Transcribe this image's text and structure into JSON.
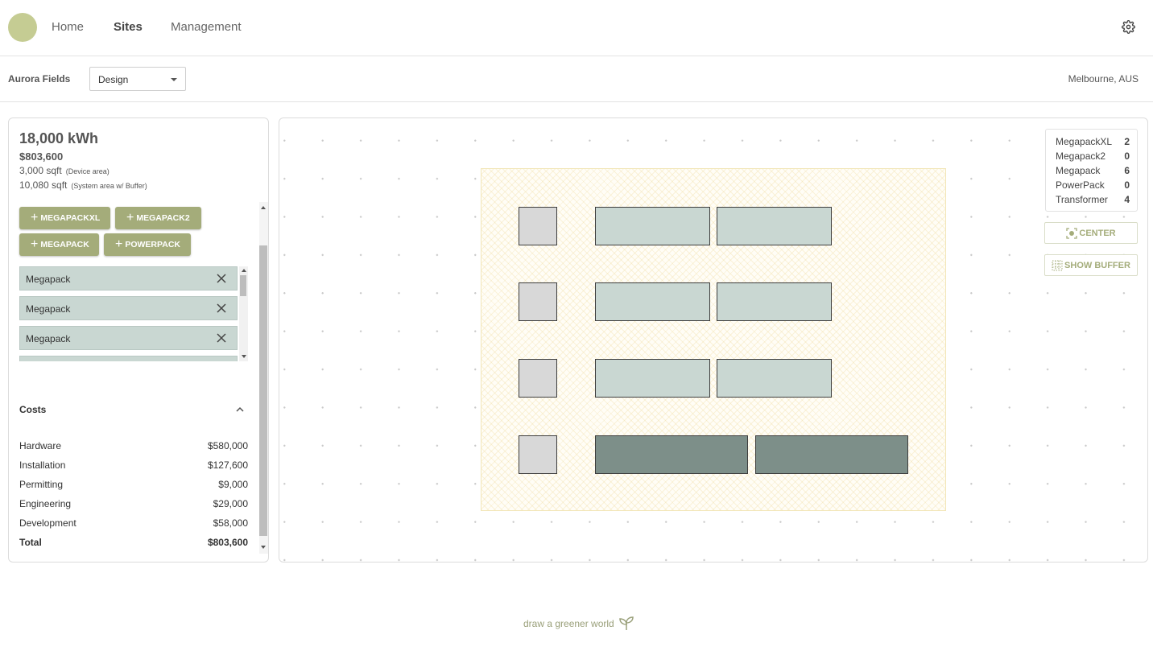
{
  "nav": {
    "links": [
      "Home",
      "Sites",
      "Management"
    ],
    "active": "Sites"
  },
  "site": {
    "name": "Aurora Fields",
    "mode": "Design",
    "location": "Melbourne, AUS"
  },
  "summary": {
    "energy": "18,000 kWh",
    "cost": "$803,600",
    "device_area": "3,000 sqft",
    "device_area_note": "(Device area)",
    "system_area": "10,080 sqft",
    "system_area_note": "(System area w/ Buffer)"
  },
  "add_buttons": [
    "MEGAPACKXL",
    "MEGAPACK2",
    "MEGAPACK",
    "POWERPACK"
  ],
  "devices": [
    "Megapack",
    "Megapack",
    "Megapack"
  ],
  "costs": {
    "title": "Costs",
    "rows": [
      {
        "name": "Hardware",
        "amount": "$580,000"
      },
      {
        "name": "Installation",
        "amount": "$127,600"
      },
      {
        "name": "Permitting",
        "amount": "$9,000"
      },
      {
        "name": "Engineering",
        "amount": "$29,000"
      },
      {
        "name": "Development",
        "amount": "$58,000"
      }
    ],
    "total_label": "Total",
    "total_amount": "$803,600"
  },
  "legend": [
    {
      "name": "MegapackXL",
      "count": "2"
    },
    {
      "name": "Megapack2",
      "count": "0"
    },
    {
      "name": "Megapack",
      "count": "6"
    },
    {
      "name": "PowerPack",
      "count": "0"
    },
    {
      "name": "Transformer",
      "count": "4"
    }
  ],
  "tools": {
    "center": "CENTER",
    "show_buffer": "SHOW BUFFER"
  },
  "footer": {
    "tagline": "draw a greener world"
  },
  "colors": {
    "accent": "#a4ac7a",
    "logo": "#c5cc93",
    "megapack": "#c9d7d2",
    "megapackxl": "#7d8f89",
    "transformer": "#d8d8d8",
    "buffer_area": "#fffdf6"
  }
}
